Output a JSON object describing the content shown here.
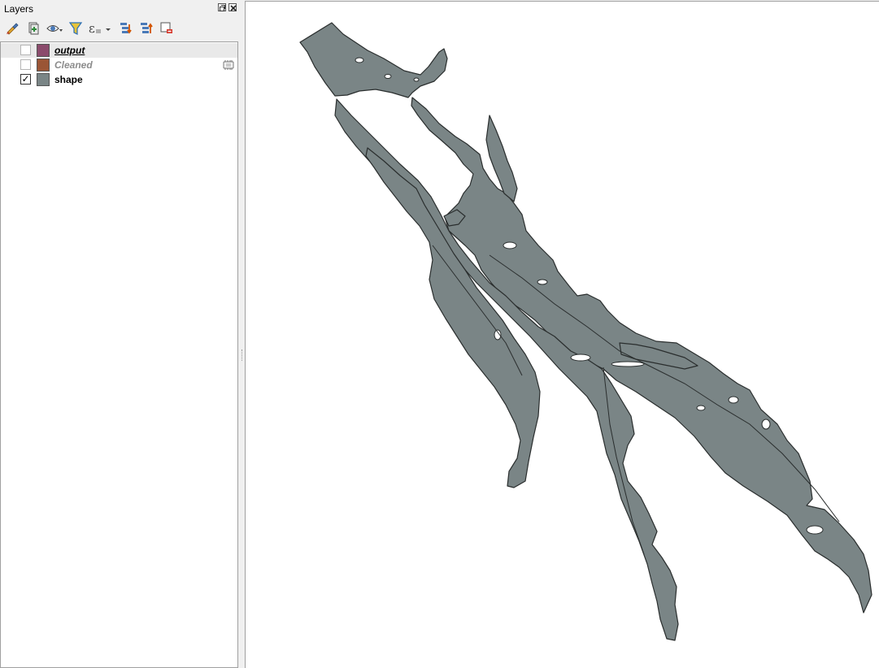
{
  "panel": {
    "title": "Layers"
  },
  "toolbar": {
    "icons": [
      "style-manager-icon",
      "add-group-icon",
      "visibility-eye-icon",
      "filter-legend-icon",
      "filter-expression-icon",
      "expand-all-icon",
      "collapse-all-icon",
      "remove-layer-icon"
    ]
  },
  "layers": [
    {
      "name": "output",
      "checked": false,
      "color": "#8b4b6c",
      "selected": true
    },
    {
      "name": "Cleaned",
      "checked": false,
      "color": "#9a5535",
      "temporary": true
    },
    {
      "name": "shape",
      "checked": true,
      "check_mark": "✓",
      "color": "#7a8586"
    }
  ],
  "map": {
    "fill_color": "#7a8586",
    "stroke_color": "#2a2e2e",
    "background": "#ffffff"
  }
}
